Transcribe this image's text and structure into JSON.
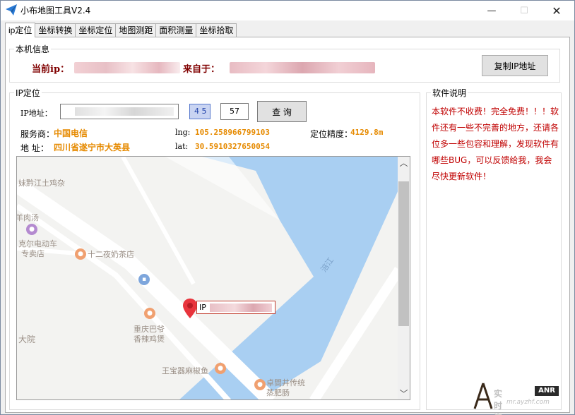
{
  "window": {
    "title": "小布地图工具V2.4",
    "minimize": "—",
    "maximize": "☐",
    "close": "✕"
  },
  "tabs": [
    {
      "label": "ip定位",
      "active": true
    },
    {
      "label": "坐标转换",
      "active": false
    },
    {
      "label": "坐标定位",
      "active": false
    },
    {
      "label": "地图测距",
      "active": false
    },
    {
      "label": "面积测量",
      "active": false
    },
    {
      "label": "坐标拾取",
      "active": false
    }
  ],
  "local_info": {
    "group_title": "本机信息",
    "current_ip_label": "当前ip：",
    "from_label": "来自于：",
    "copy_button": "复制IP地址"
  },
  "ip_locate": {
    "group_title": "IP定位",
    "ip_label": "IP地址：",
    "spinner_value": "4 5",
    "number_field": "57",
    "query_button": "查 询",
    "isp_label": "服务商：",
    "isp_value": "中国电信",
    "address_label": "地 址：",
    "address_value": "四川省遂宁市大英县",
    "lng_label": "lng:",
    "lng_value": "105.258966799103",
    "lat_label": "lat:",
    "lat_value": "30.5910327650054",
    "accuracy_label": "定位精度：",
    "accuracy_value": "4129.8m"
  },
  "map": {
    "pois": [
      {
        "name": "妹黔江土鸡杂"
      },
      {
        "name": "羊肉汤"
      },
      {
        "name": "克尔电动车"
      },
      {
        "name": "专卖店"
      },
      {
        "name": "十二夜奶茶店"
      },
      {
        "name": "重庆巴爷"
      },
      {
        "name": "香辣鸡煲"
      },
      {
        "name": "大院"
      },
      {
        "name": "王宝器麻椒鱼"
      },
      {
        "name": "卓間井传统"
      },
      {
        "name": "蒸肥肠"
      },
      {
        "name": "涪江"
      }
    ],
    "marker_label": "IP"
  },
  "description": {
    "group_title": "软件说明",
    "text": "本软件不收费！完全免费！！！软件还有一些不完善的地方，还请各位多一些包容和理解，发现软件有哪些BUG，可以反馈给我，我会尽快更新软件！"
  },
  "watermark": {
    "text": "实时资源",
    "badge": "ANR",
    "url": "mr.ayzhf.com"
  },
  "colors": {
    "accent_red": "#c00000",
    "orange": "#e68a00",
    "maroon": "#800000"
  }
}
